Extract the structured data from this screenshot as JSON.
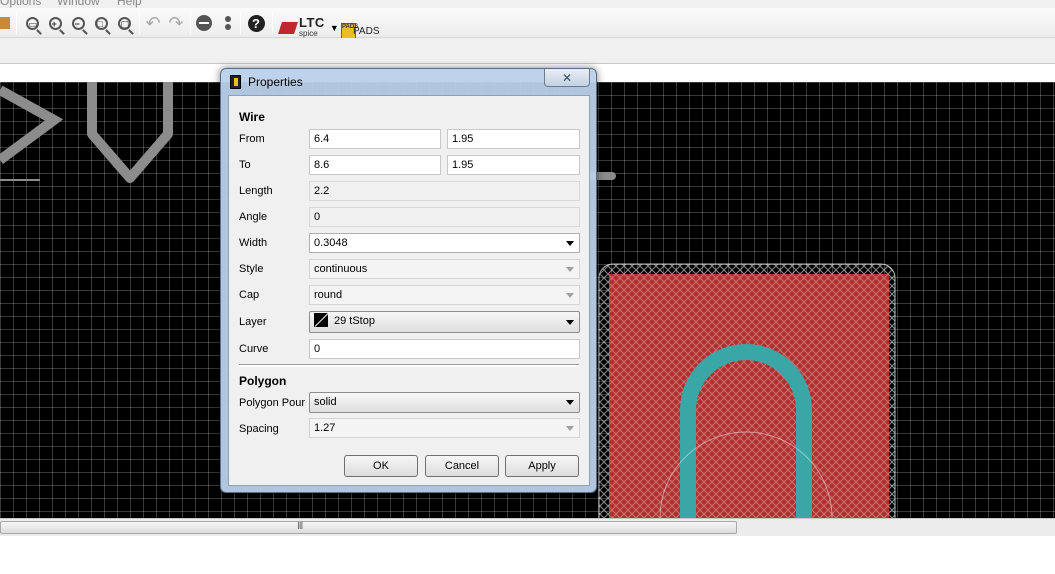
{
  "menubar": {
    "items": [
      "Options",
      "Window",
      "Help"
    ]
  },
  "toolbar": {
    "zoom_icons": [
      "zoom-fit-icon",
      "zoom-in-icon",
      "zoom-out-icon",
      "zoom-select-icon",
      "zoom-redraw-icon"
    ],
    "ltc_label": "LTC",
    "ltc_sub": "spice",
    "pads_box": "PADS",
    "pads_label": "PADS"
  },
  "dialog": {
    "title": "Properties",
    "close_glyph": "✕",
    "wire": {
      "section": "Wire",
      "from_label": "From",
      "from_x": "6.4",
      "from_y": "1.95",
      "to_label": "To",
      "to_x": "8.6",
      "to_y": "1.95",
      "length_label": "Length",
      "length": "2.2",
      "angle_label": "Angle",
      "angle": "0",
      "width_label": "Width",
      "width": "0.3048",
      "style_label": "Style",
      "style": "continuous",
      "cap_label": "Cap",
      "cap": "round",
      "layer_label": "Layer",
      "layer": "29 tStop",
      "curve_label": "Curve",
      "curve": "0"
    },
    "polygon": {
      "section": "Polygon",
      "pour_label": "Polygon Pour",
      "pour": "solid",
      "spacing_label": "Spacing",
      "spacing": "1.27"
    },
    "buttons": {
      "ok": "OK",
      "cancel": "Cancel",
      "apply": "Apply"
    }
  },
  "scrollbar": {
    "grip": "III"
  },
  "status": {
    "text": ""
  },
  "colors": {
    "canvas_bg": "#000000",
    "pad_red": "#b03030",
    "trace_teal": "#3aa6a6",
    "silk_gray": "#8c8c8c"
  }
}
